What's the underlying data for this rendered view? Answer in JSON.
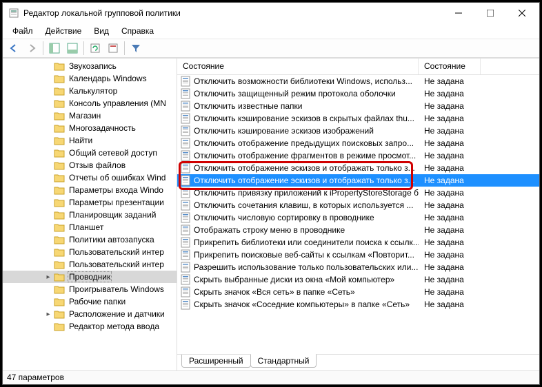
{
  "window": {
    "title": "Редактор локальной групповой политики"
  },
  "menu": {
    "file": "Файл",
    "action": "Действие",
    "view": "Вид",
    "help": "Справка"
  },
  "tree": {
    "items": [
      {
        "label": "Звукозапись"
      },
      {
        "label": "Календарь Windows"
      },
      {
        "label": "Калькулятор"
      },
      {
        "label": "Консоль управления (MN"
      },
      {
        "label": "Магазин"
      },
      {
        "label": "Многозадачность"
      },
      {
        "label": "Найти"
      },
      {
        "label": "Общий сетевой доступ"
      },
      {
        "label": "Отзыв файлов"
      },
      {
        "label": "Отчеты об ошибках Wind"
      },
      {
        "label": "Параметры входа Windo"
      },
      {
        "label": "Параметры презентации"
      },
      {
        "label": "Планировщик заданий"
      },
      {
        "label": "Планшет"
      },
      {
        "label": "Политики автозапуска"
      },
      {
        "label": "Пользовательский интер"
      },
      {
        "label": "Пользовательский интер"
      },
      {
        "label": "Проводник",
        "selected": true,
        "expandable": true,
        "expanded": false
      },
      {
        "label": "Проигрыватель Windows"
      },
      {
        "label": "Рабочие папки"
      },
      {
        "label": "Расположение и датчики",
        "expandable": true,
        "expanded": false
      },
      {
        "label": "Редактор метода ввода"
      }
    ]
  },
  "list": {
    "col1": "Состояние",
    "col2": "Состояние",
    "state": "Не задана",
    "rows": [
      {
        "name": "Отключить возможности библиотеки Windows, использ..."
      },
      {
        "name": "Отключить защищенный режим протокола оболочки"
      },
      {
        "name": "Отключить известные папки"
      },
      {
        "name": "Отключить кэширование эскизов в скрытых файлах thu..."
      },
      {
        "name": "Отключить кэширование эскизов изображений"
      },
      {
        "name": "Отключить отображение предыдущих поисковых запро..."
      },
      {
        "name": "Отключить отображение фрагментов в режиме просмот..."
      },
      {
        "name": "Отключить отображение эскизов и отображать только з...",
        "highlighted": true
      },
      {
        "name": "Отключить отображение эскизов и отображать только з...",
        "selected": true,
        "highlighted": true
      },
      {
        "name": "Отключить привязку приложений к iPropertyStoreStorage без при..."
      },
      {
        "name": "Отключить сочетания клавиш, в которых используется ..."
      },
      {
        "name": "Отключить числовую сортировку в проводнике"
      },
      {
        "name": "Отображать строку меню в проводнике"
      },
      {
        "name": "Прикрепить библиотеки или соединители поиска к ссылк..."
      },
      {
        "name": "Прикрепить поисковые веб-сайты к ссылкам «Повторит..."
      },
      {
        "name": "Разрешить использование только пользовательских или..."
      },
      {
        "name": "Скрыть выбранные диски из окна «Мой компьютер»"
      },
      {
        "name": "Скрыть значок «Вся сеть» в папке «Сеть»"
      },
      {
        "name": "Скрыть значок «Соседние компьютеры» в папке «Сеть»"
      }
    ]
  },
  "tabs": {
    "ext": "Расширенный",
    "std": "Стандартный"
  },
  "status": {
    "text": "47 параметров"
  }
}
